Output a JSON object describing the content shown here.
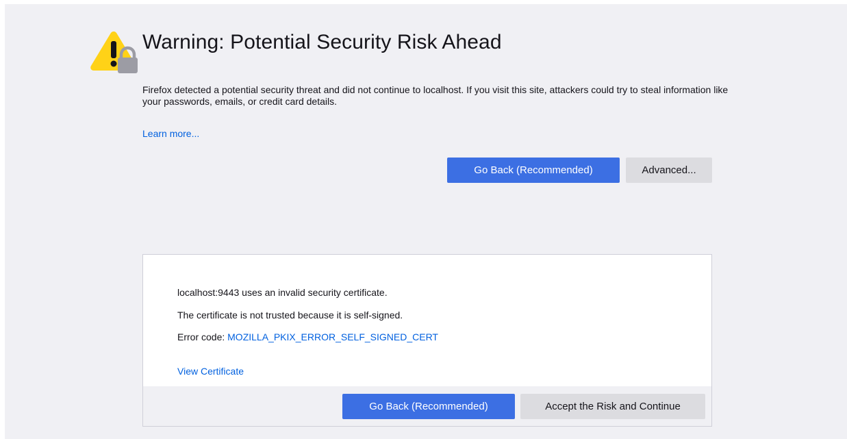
{
  "header": {
    "title": "Warning: Potential Security Risk Ahead",
    "icon": "warning-lock-icon"
  },
  "intro": {
    "text": "Firefox detected a potential security threat and did not continue to localhost. If you visit this site, attackers could try to steal information like your passwords, emails, or credit card details.",
    "learn_more": "Learn more..."
  },
  "actions": {
    "go_back_label": "Go Back (Recommended)",
    "advanced_label": "Advanced..."
  },
  "advanced_panel": {
    "line1": "localhost:9443 uses an invalid security certificate.",
    "line2": "The certificate is not trusted because it is self-signed.",
    "error_code_prefix": "Error code: ",
    "error_code": "MOZILLA_PKIX_ERROR_SELF_SIGNED_CERT",
    "view_certificate": "View Certificate",
    "go_back_label": "Go Back (Recommended)",
    "accept_label": "Accept the Risk and Continue"
  },
  "colors": {
    "background": "#f0f0f4",
    "primary_button": "#3c6fe3",
    "secondary_button": "#dcdce0",
    "link": "#0060df",
    "warning_yellow": "#ffd217"
  }
}
